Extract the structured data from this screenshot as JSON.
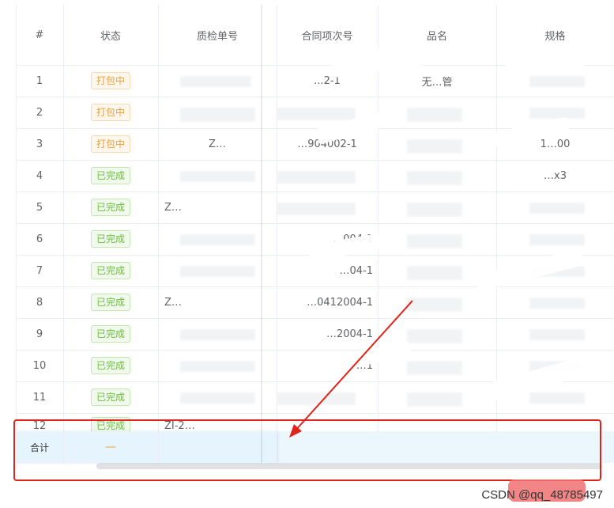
{
  "table": {
    "columns": [
      "#",
      "状态",
      "质检单号",
      "合同项次号",
      "品名",
      "规格"
    ],
    "rows": [
      {
        "index": "1",
        "status": "打包中",
        "status_type": "warning",
        "qc_no": "",
        "contract_item": "...2-1",
        "name": "无…管",
        "spec": ""
      },
      {
        "index": "2",
        "status": "打包中",
        "status_type": "warning",
        "qc_no": "",
        "contract_item": "",
        "name": "",
        "spec": ""
      },
      {
        "index": "3",
        "status": "打包中",
        "status_type": "warning",
        "qc_no": "Z…",
        "contract_item": "…904002-1",
        "name": "",
        "spec": "1…00"
      },
      {
        "index": "4",
        "status": "已完成",
        "status_type": "success",
        "qc_no": "",
        "contract_item": "",
        "name": "",
        "spec": "…x3"
      },
      {
        "index": "5",
        "status": "已完成",
        "status_type": "success",
        "qc_no": "Z…",
        "contract_item": "",
        "name": "",
        "spec": ""
      },
      {
        "index": "6",
        "status": "已完成",
        "status_type": "success",
        "qc_no": "",
        "contract_item": "…004-1",
        "name": "",
        "spec": ""
      },
      {
        "index": "7",
        "status": "已完成",
        "status_type": "success",
        "qc_no": "",
        "contract_item": "…04-1",
        "name": "",
        "spec": ""
      },
      {
        "index": "8",
        "status": "已完成",
        "status_type": "success",
        "qc_no": "Z…",
        "contract_item": "…0412004-1",
        "name": "",
        "spec": ""
      },
      {
        "index": "9",
        "status": "已完成",
        "status_type": "success",
        "qc_no": "",
        "contract_item": "…2004-1",
        "name": "",
        "spec": ""
      },
      {
        "index": "10",
        "status": "已完成",
        "status_type": "success",
        "qc_no": "",
        "contract_item": "…1",
        "name": "",
        "spec": ""
      },
      {
        "index": "11",
        "status": "已完成",
        "status_type": "success",
        "qc_no": "",
        "contract_item": "",
        "name": "",
        "spec": ""
      },
      {
        "index": "12",
        "status": "已完成",
        "status_type": "success",
        "qc_no": "ZI-2…",
        "contract_item": "",
        "name": "",
        "spec": ""
      }
    ],
    "summary": {
      "label": "合计",
      "status_value": "—"
    }
  },
  "watermark": {
    "text": "CSDN @qq_48785497"
  },
  "colors": {
    "annotation_red": "#e2231a",
    "warning": "#e6a23c",
    "success": "#67c23a",
    "summary_bg": "#ecf6fd"
  }
}
